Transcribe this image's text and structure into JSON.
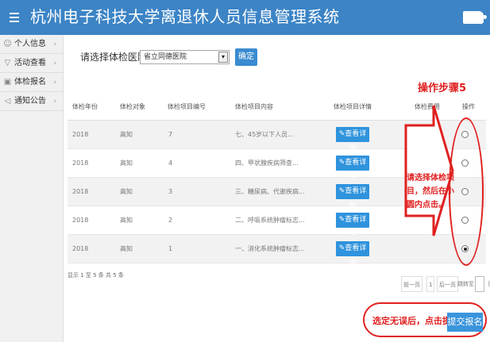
{
  "app": {
    "title": "杭州电子科技大学离退休人员信息管理系统"
  },
  "sidebar": {
    "items": [
      {
        "label": "个人信息",
        "icon": "person-icon"
      },
      {
        "label": "活动查看",
        "icon": "flag-icon"
      },
      {
        "label": "体检报名",
        "icon": "calendar-icon"
      },
      {
        "label": "通知公告",
        "icon": "megaphone-icon"
      }
    ]
  },
  "filter": {
    "label": "请选择体检医院:",
    "selected": "省立同德医院",
    "confirm": "确定"
  },
  "table": {
    "headers": [
      "体检年份",
      "体检对象",
      "体检项目编号",
      "体检项目内容",
      "体检项目详情",
      "体检费用",
      "操作"
    ],
    "detail_label": "查看详情",
    "rows": [
      {
        "year": "2018",
        "target": "高知",
        "no": "7",
        "content": "七、45岁以下人员...",
        "selected": false
      },
      {
        "year": "2018",
        "target": "高知",
        "no": "4",
        "content": "四、甲状腺疾病筛查...",
        "selected": false
      },
      {
        "year": "2018",
        "target": "高知",
        "no": "3",
        "content": "三、糖尿病、代谢疾病...",
        "selected": false
      },
      {
        "year": "2018",
        "target": "高知",
        "no": "2",
        "content": "二、呼吸系统肿瘤标志...",
        "selected": false
      },
      {
        "year": "2018",
        "target": "高知",
        "no": "1",
        "content": "一、消化系统肿瘤标志...",
        "selected": true
      }
    ]
  },
  "summary": "显示 1 至 5 条  共 5 条",
  "pager": {
    "prev": "前一页",
    "page": "1",
    "next": "后一页",
    "jump": "跳转至",
    "page_unit": "页"
  },
  "annotations": {
    "step": "操作步骤5",
    "instruction": "请选择体检项目，然后在小圆内点击。",
    "submit_hint": "选定无误后，点击提交"
  },
  "submit": {
    "label": "提交报名"
  },
  "colors": {
    "header": "#3c84c6",
    "button": "#3a95dc",
    "annotation": "#e02020"
  }
}
